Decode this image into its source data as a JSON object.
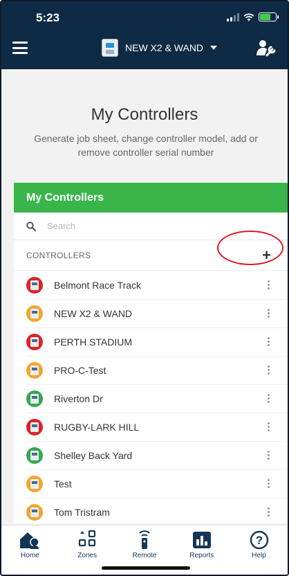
{
  "status_bar": {
    "time": "5:23"
  },
  "header": {
    "controller_name": "NEW X2 & WAND"
  },
  "page": {
    "title": "My Controllers",
    "subtitle": "Generate job sheet, change controller model, add or remove controller serial number"
  },
  "card": {
    "title": "My Controllers",
    "search_placeholder": "Search",
    "section_label": "CONTROLLERS",
    "add_symbol": "+"
  },
  "controllers": [
    {
      "name": "Belmont Race Track",
      "status_color": "#d9252b"
    },
    {
      "name": "NEW X2 & WAND",
      "status_color": "#f2a62b"
    },
    {
      "name": "PERTH STADIUM",
      "status_color": "#d9252b"
    },
    {
      "name": "PRO-C-Test",
      "status_color": "#f2a62b"
    },
    {
      "name": "Riverton Dr",
      "status_color": "#35a853"
    },
    {
      "name": "RUGBY-LARK HILL",
      "status_color": "#d9252b"
    },
    {
      "name": "Shelley Back Yard",
      "status_color": "#35a853"
    },
    {
      "name": "Test",
      "status_color": "#f2a62b"
    },
    {
      "name": "Tom Tristram",
      "status_color": "#f2a62b"
    }
  ],
  "tabs": [
    {
      "label": "Home",
      "icon": "home-icon"
    },
    {
      "label": "Zones",
      "icon": "zones-icon"
    },
    {
      "label": "Remote",
      "icon": "remote-icon"
    },
    {
      "label": "Reports",
      "icon": "reports-icon"
    },
    {
      "label": "Help",
      "icon": "help-icon"
    }
  ],
  "colors": {
    "header_bg": "#0f2a44",
    "card_header": "#3ab54a",
    "highlight": "#e01822",
    "tab_icon": "#143655"
  }
}
